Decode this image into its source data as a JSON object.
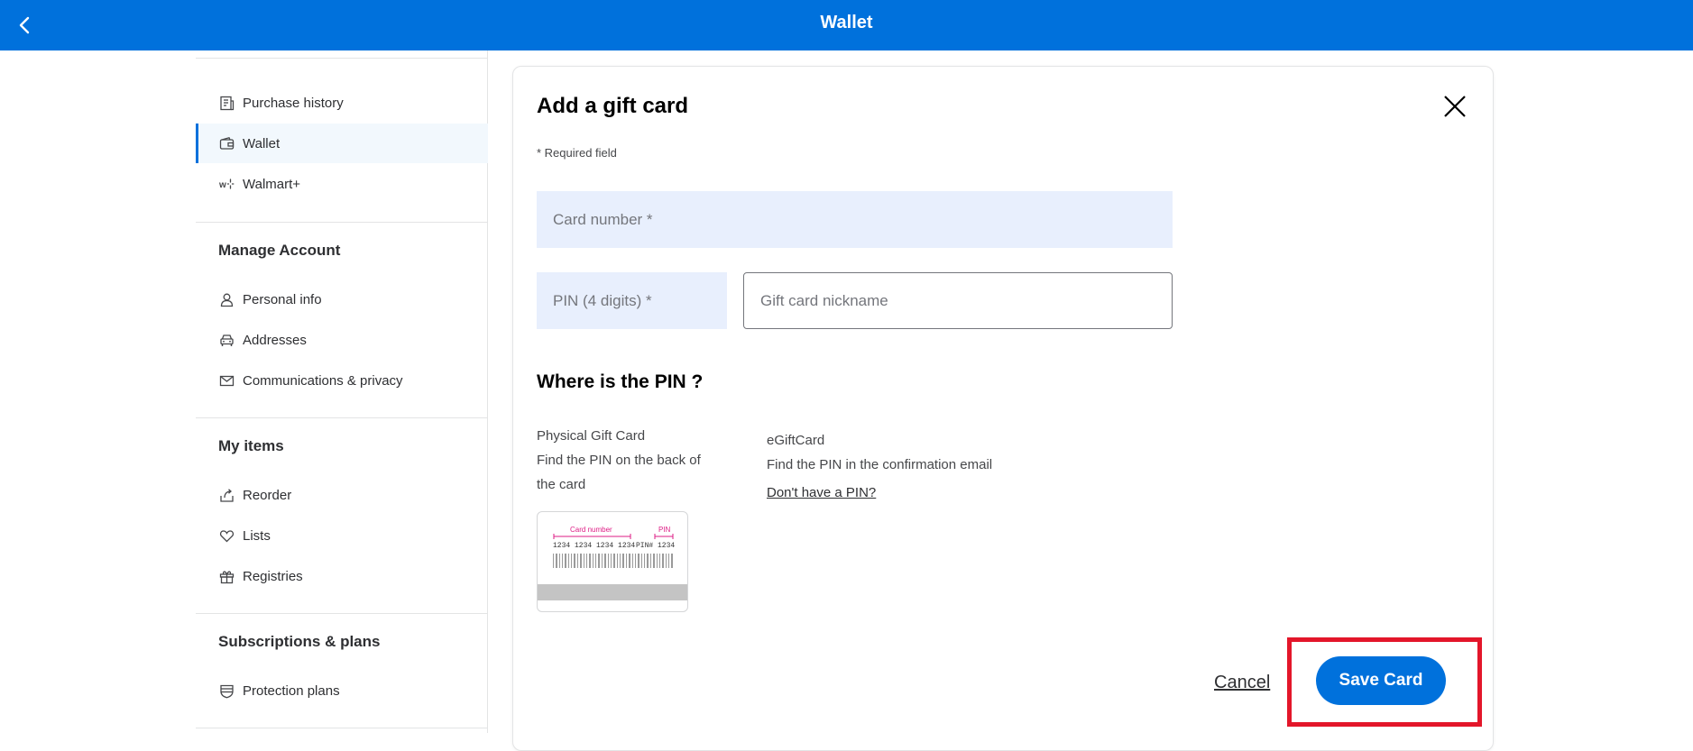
{
  "header": {
    "title": "Wallet",
    "back_icon": "chevron-left-icon"
  },
  "sidebar": {
    "top_items": [
      {
        "label": "Purchase history",
        "icon": "receipt-icon"
      },
      {
        "label": "Wallet",
        "icon": "wallet-icon",
        "active": true
      },
      {
        "label": "Walmart+",
        "icon": "walmart-plus-icon"
      }
    ],
    "sections": [
      {
        "title": "Manage Account",
        "items": [
          {
            "label": "Personal info",
            "icon": "person-icon"
          },
          {
            "label": "Addresses",
            "icon": "car-icon"
          },
          {
            "label": "Communications & privacy",
            "icon": "envelope-icon"
          }
        ]
      },
      {
        "title": "My items",
        "items": [
          {
            "label": "Reorder",
            "icon": "reorder-icon"
          },
          {
            "label": "Lists",
            "icon": "heart-icon"
          },
          {
            "label": "Registries",
            "icon": "gift-icon"
          }
        ]
      },
      {
        "title": "Subscriptions & plans",
        "items": [
          {
            "label": "Protection plans",
            "icon": "shield-icon"
          }
        ]
      }
    ]
  },
  "dialog": {
    "title": "Add a gift card",
    "required_note": "* Required field",
    "card_number_placeholder": "Card number *",
    "pin_placeholder": "PIN (4 digits) *",
    "nickname_placeholder": "Gift card nickname",
    "pin_heading": "Where is the PIN ?",
    "physical": {
      "title": "Physical Gift Card",
      "desc": "Find the PIN on the back of the card"
    },
    "egift": {
      "title": "eGiftCard",
      "desc": "Find the PIN in the confirmation email"
    },
    "no_pin_link": "Don't have a PIN?",
    "card_image": {
      "card_number_label": "Card number",
      "pin_label": "PIN",
      "digits": "1234 1234 1234 1234",
      "pin_digits": "PIN# 1234"
    },
    "cancel_label": "Cancel",
    "save_label": "Save Card"
  },
  "colors": {
    "brand": "#0071dc",
    "highlight": "#e3162a",
    "field_bg": "#e8effd",
    "card_accent": "#de1c85"
  }
}
